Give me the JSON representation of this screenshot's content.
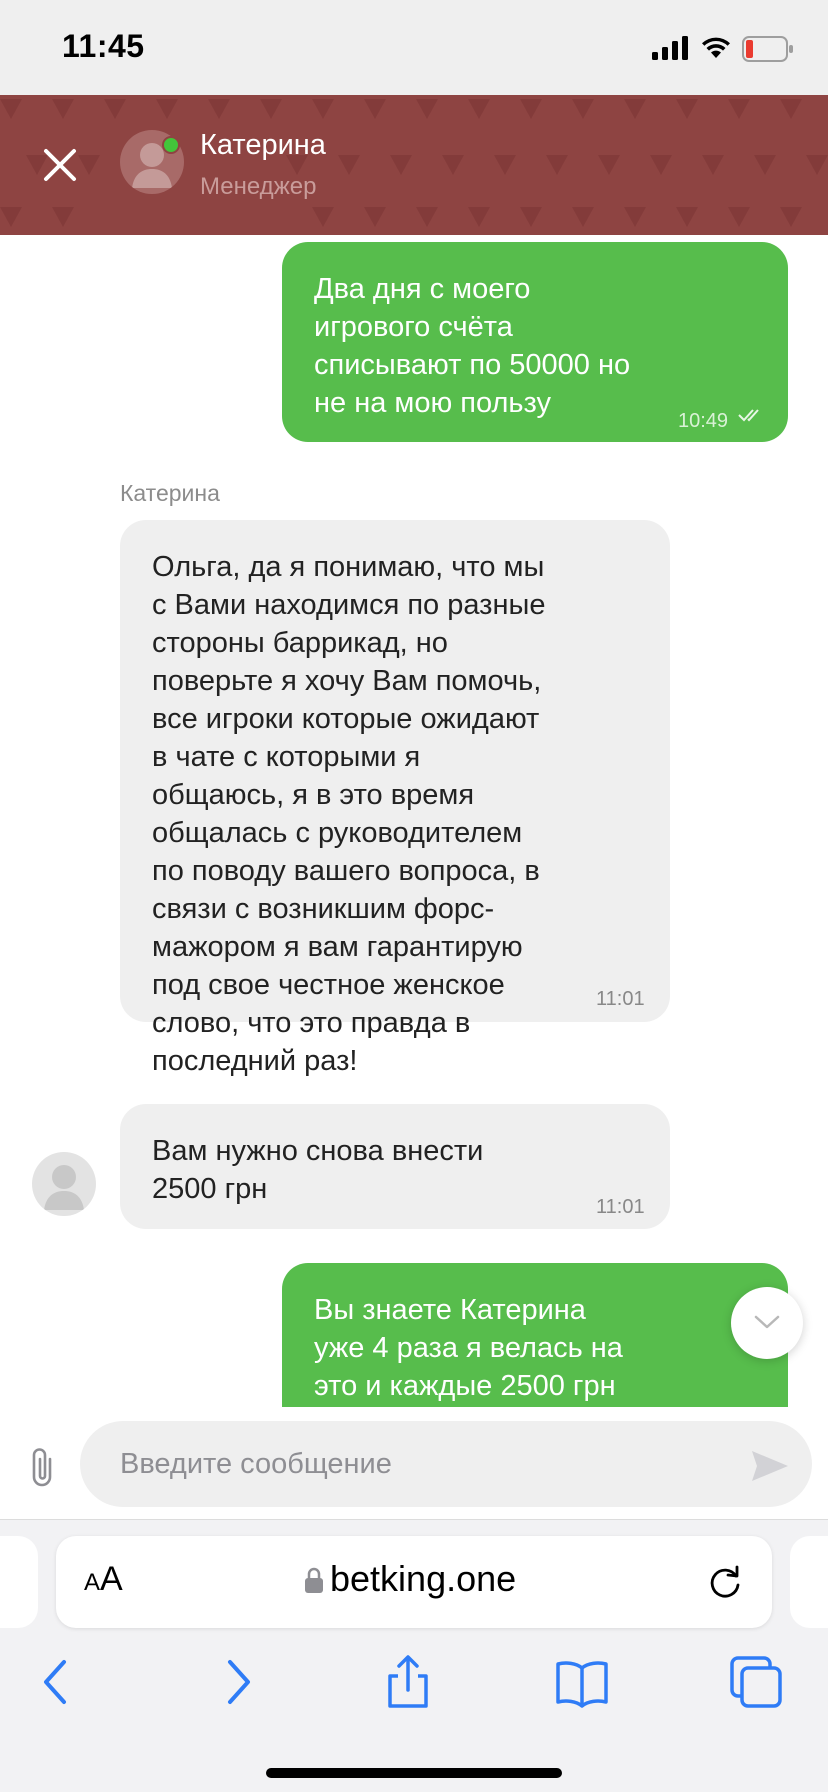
{
  "status_bar": {
    "time": "11:45"
  },
  "header": {
    "name": "Катерина",
    "role": "Менеджер",
    "online": true,
    "background": "#8e4442"
  },
  "messages": [
    {
      "direction": "out",
      "text": "Два дня с моего\nигрового счёта\nсписывают по 50000 но\nне на мою пользу",
      "time": "10:49",
      "read": true
    },
    {
      "direction": "in",
      "sender": "Катерина",
      "text": "Ольга, да я понимаю, что мы\nс Вами находимся по разные\nстороны баррикад, но\nповерьте я хочу Вам помочь,\nвсе игроки которые ожидают\nв чате с которыми я\nобщаюсь, я в это время\nобщалась с руководителем\nпо поводу вашего вопроса, в\nсвязи с возникшим форс-\nмажором я вам гарантирую\nпод свое честное женское\nслово, что это правда в\nпоследний раз!",
      "time": "11:01"
    },
    {
      "direction": "in",
      "text": "Вам нужно снова внести\n2500 грн",
      "time": "11:01"
    },
    {
      "direction": "out",
      "text": "Вы знаете Катерина\nуже 4 раза я велась на\nэто и каждые 2500 грн",
      "time": ""
    }
  ],
  "composer": {
    "placeholder": "Введите сообщение"
  },
  "browser": {
    "reader_label_small": "A",
    "reader_label_big": "A",
    "url": "betking.one"
  },
  "icons": [
    "close-icon",
    "avatar-placeholder-icon",
    "read-checkmarks-icon",
    "chevron-down-icon",
    "paperclip-icon",
    "send-icon",
    "lock-icon",
    "reload-icon",
    "back-icon",
    "forward-icon",
    "share-icon",
    "bookmarks-icon",
    "tabs-icon"
  ],
  "colors": {
    "outgoing": "#57bd4c",
    "incoming": "#efefef",
    "accent": "#2f7cf6"
  }
}
